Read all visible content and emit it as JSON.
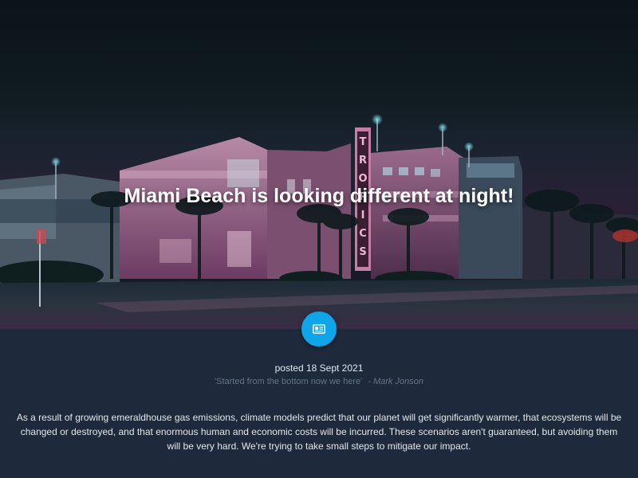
{
  "hero": {
    "title": "Miami Beach is looking different at night!",
    "sign_letters": [
      "T",
      "R",
      "O",
      "P",
      "I",
      "C",
      "S"
    ]
  },
  "badge": {
    "icon": "newspaper-icon",
    "color": "#0ea5e9"
  },
  "post": {
    "posted": "posted 18 Sept 2021",
    "quote": "'Started from the bottom now we here'",
    "author": "- Mark Jonson",
    "body": "As a result of growing emeraldhouse gas emissions, climate models predict that our planet will get significantly warmer, that ecosystems will be changed or destroyed, and that enormous human and economic costs will be incurred. These scenarios aren't guaranteed, but avoiding them will be very hard. We're trying to take small steps to mitigate our impact."
  },
  "colors": {
    "page_bg": "#1e293b",
    "accent": "#0ea5e9"
  }
}
